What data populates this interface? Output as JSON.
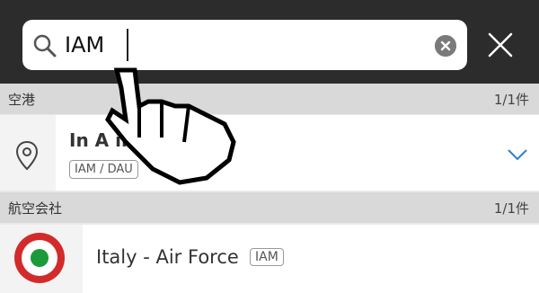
{
  "search": {
    "query": "IAM"
  },
  "sections": [
    {
      "title": "空港",
      "count": "1/1件"
    },
    {
      "title": "航空会社",
      "count": "1/1件"
    }
  ],
  "airport_result": {
    "name": "In Amenas Airport / Zarzaitine Airport",
    "name_visible": "In A                   ine Airport",
    "codes": "IAM / DAU"
  },
  "airline_result": {
    "name": "Italy - Air Force",
    "code": "IAM"
  },
  "icons": {
    "search": "search-icon",
    "clear": "clear-icon",
    "close": "close-icon",
    "pin": "location-pin-icon",
    "chevron": "chevron-down-icon",
    "roundel": "italian-air-force-roundel",
    "cursor": "hand-pointer-cursor"
  }
}
